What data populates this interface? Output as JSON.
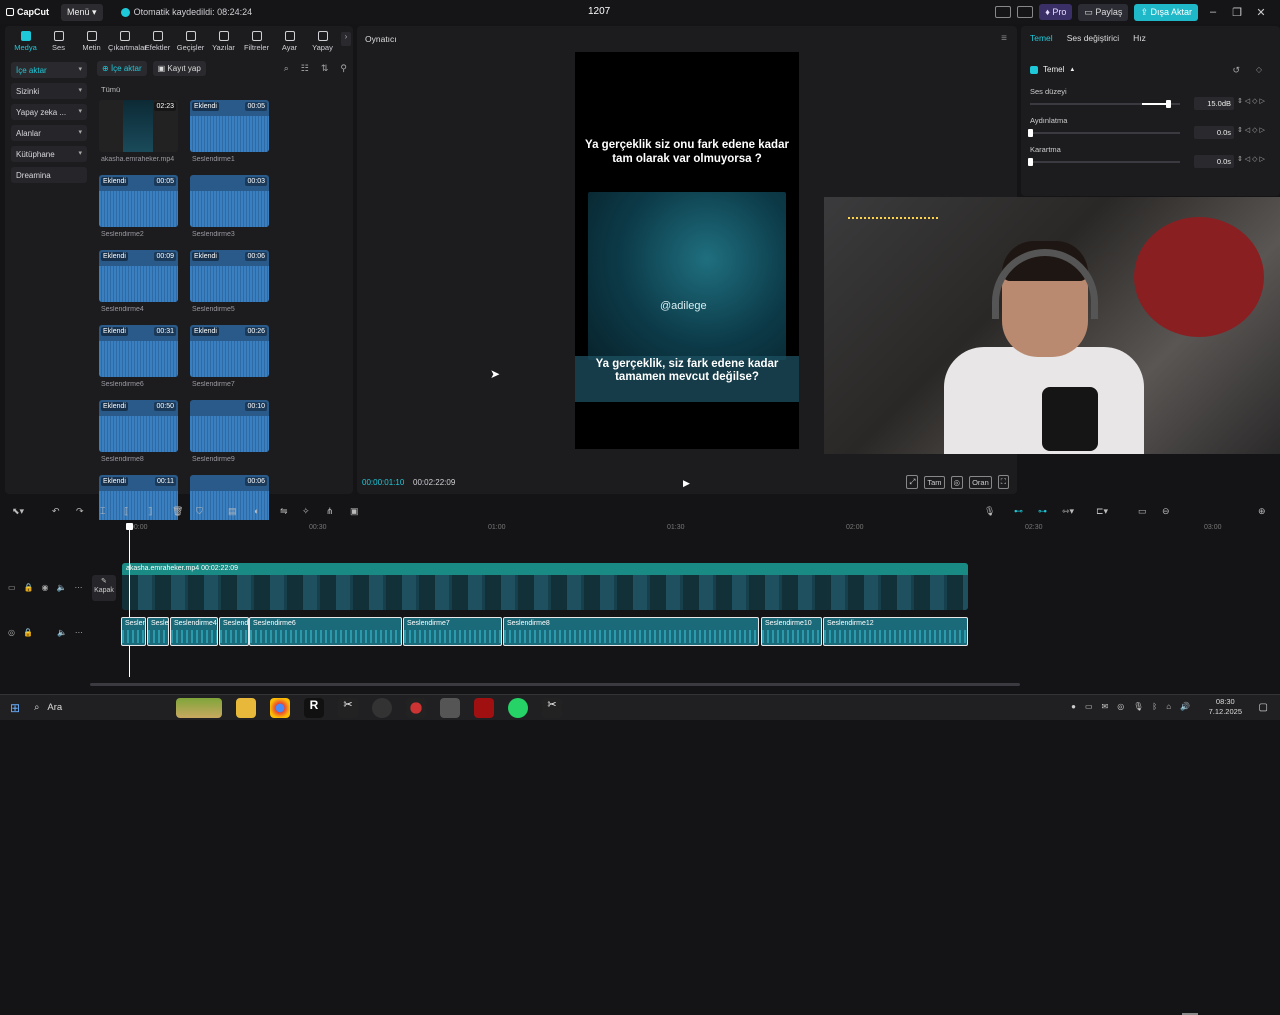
{
  "app": {
    "logo": "CapCut",
    "menu_label": "Menü",
    "autosave": "Otomatik kaydedildi: 08:24:24",
    "project_title": "1207",
    "pro_label": "Pro",
    "share_label": "Paylaş",
    "export_label": "Dışa Aktar",
    "accent_color": "#1fc8d8"
  },
  "toptabs": [
    {
      "label": "Medya",
      "icon": "media-icon"
    },
    {
      "label": "Ses",
      "icon": "audio-icon"
    },
    {
      "label": "Metin",
      "icon": "text-icon"
    },
    {
      "label": "Çıkartmalar",
      "icon": "sticker-icon"
    },
    {
      "label": "Efektler",
      "icon": "effects-icon"
    },
    {
      "label": "Geçişler",
      "icon": "transitions-icon"
    },
    {
      "label": "Yazılar",
      "icon": "captions-icon"
    },
    {
      "label": "Filtreler",
      "icon": "filters-icon"
    },
    {
      "label": "Ayar",
      "icon": "adjust-icon"
    },
    {
      "label": "Yapay",
      "icon": "ai-icon"
    }
  ],
  "sidenav": [
    {
      "label": "İçe aktar"
    },
    {
      "label": "Sizinki"
    },
    {
      "label": "Yapay zeka ..."
    },
    {
      "label": "Alanlar"
    },
    {
      "label": "Kütüphane"
    },
    {
      "label": "Dreamina"
    }
  ],
  "media": {
    "import_label": "İçe aktar",
    "record_label": "Kayıt yap",
    "section_label": "Tümü",
    "items": [
      {
        "name": "akasha.emraheker.mp4",
        "duration": "02:23",
        "badge": ""
      },
      {
        "name": "Seslendirme1",
        "duration": "00:05",
        "badge": "Eklendi"
      },
      {
        "name": "Seslendirme2",
        "duration": "00:05",
        "badge": "Eklendi"
      },
      {
        "name": "Seslendirme3",
        "duration": "00:03",
        "badge": ""
      },
      {
        "name": "Seslendirme4",
        "duration": "00:09",
        "badge": "Eklendi"
      },
      {
        "name": "Seslendirme5",
        "duration": "00:06",
        "badge": "Eklendi"
      },
      {
        "name": "Seslendirme6",
        "duration": "00:31",
        "badge": "Eklendi"
      },
      {
        "name": "Seslendirme7",
        "duration": "00:26",
        "badge": "Eklendi"
      },
      {
        "name": "Seslendirme8",
        "duration": "00:50",
        "badge": "Eklendi"
      },
      {
        "name": "Seslendirme9",
        "duration": "00:10",
        "badge": ""
      },
      {
        "name": "",
        "duration": "00:11",
        "badge": "Eklendi"
      },
      {
        "name": "",
        "duration": "00:06",
        "badge": ""
      }
    ]
  },
  "player": {
    "title": "Oynatıcı",
    "caption_top": "Ya gerçeklik siz onu fark edene kadar tam olarak var olmuyorsa ?",
    "handle": "@adilege",
    "caption_bottom": "Ya gerçeklik, siz fark edene kadar tamamen mevcut değilse?",
    "time_current": "00:00:01:10",
    "time_total": "00:02:22:09",
    "btn_full": "Tam",
    "btn_ratio": "Oran"
  },
  "inspector": {
    "tabs": [
      "Temel",
      "Ses değiştirici",
      "Hız"
    ],
    "section": "Temel",
    "params": [
      {
        "label": "Ses düzeyi",
        "value": "15.0dB",
        "level": 0.92
      },
      {
        "label": "Aydınlatma",
        "value": "0.0s",
        "level": 0
      },
      {
        "label": "Karartma",
        "value": "0.0s",
        "level": 0
      }
    ]
  },
  "timeline": {
    "ruler": [
      "00:00",
      "00:30",
      "01:00",
      "01:30",
      "02:00",
      "02:30",
      "03:00"
    ],
    "cover_label": "Kapak",
    "video_clip": "akasha.emraheker.mp4  00:02:22:09",
    "audio_clips": [
      {
        "label": "Sesler"
      },
      {
        "label": "Sesler"
      },
      {
        "label": "Seslendirme4"
      },
      {
        "label": "Seslendi"
      },
      {
        "label": "Seslendirme6"
      },
      {
        "label": "Seslendirme7"
      },
      {
        "label": "Seslendirme8"
      },
      {
        "label": "Seslendirme10"
      },
      {
        "label": "Seslendirme12"
      }
    ]
  },
  "taskbar": {
    "search_label": "Ara",
    "time": "08:30",
    "date": "7.12.2025"
  }
}
